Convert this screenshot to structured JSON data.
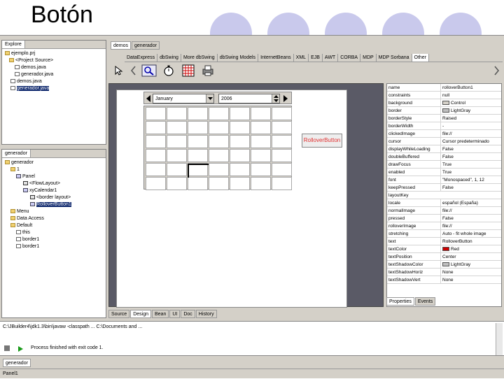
{
  "slide": {
    "title": "Botón"
  },
  "explorer": {
    "tabs": [
      "Explore"
    ],
    "nodes": [
      {
        "label": "ejemplo.prj",
        "icon": "folder"
      },
      {
        "label": "<Project Source>",
        "icon": "folder"
      },
      {
        "label": "demos.java",
        "icon": "file"
      },
      {
        "label": "generador.java",
        "icon": "file"
      },
      {
        "label": "demos.java",
        "icon": "file"
      },
      {
        "label": "generador.java",
        "icon": "file"
      }
    ]
  },
  "structure": {
    "tab": "generador",
    "nodes": [
      {
        "label": "generador",
        "icon": "folder"
      },
      {
        "label": "1",
        "icon": "folder"
      },
      {
        "label": "Panel",
        "icon": "comp"
      },
      {
        "label": "<FlowLayout>",
        "icon": "lay"
      },
      {
        "label": "xyCalendar1",
        "icon": "comp"
      },
      {
        "label": "<border layout>",
        "icon": "lay"
      },
      {
        "label": "RolloverButton1",
        "icon": "comp"
      },
      {
        "label": "Menu",
        "icon": "folder"
      },
      {
        "label": "Data Access",
        "icon": "folder"
      },
      {
        "label": "Default",
        "icon": "folder"
      },
      {
        "label": "this",
        "icon": "file"
      },
      {
        "label": "border1",
        "icon": "file"
      },
      {
        "label": "border1",
        "icon": "file"
      }
    ]
  },
  "editor_tabs": [
    "demos",
    "generador"
  ],
  "palette": {
    "tabs": [
      "DataExpress",
      "dbSwing",
      "More dbSwing",
      "dbSwing Models",
      "InternetBeans",
      "XML",
      "EJB",
      "AWT",
      "CORBA",
      "MDP",
      "MDP Sorbana",
      "Other"
    ],
    "active": "Other"
  },
  "calendar": {
    "month": "January",
    "year": "2006"
  },
  "rollover_button": {
    "label": "RolloverButton"
  },
  "properties": [
    {
      "name": "name",
      "value": "rolloverButton1"
    },
    {
      "name": "constraints",
      "value": "null"
    },
    {
      "name": "background",
      "value": "Control",
      "swatch": "#d4d0c8"
    },
    {
      "name": "border",
      "value": "LightGray",
      "swatch": "#c0c0c0"
    },
    {
      "name": "borderStyle",
      "value": "Raised"
    },
    {
      "name": "borderWidth",
      "value": "-"
    },
    {
      "name": "clickedImage",
      "value": "file://"
    },
    {
      "name": "cursor",
      "value": "Cursor predeterminado"
    },
    {
      "name": "displayWhileLoading",
      "value": "False"
    },
    {
      "name": "doubleBuffered",
      "value": "False"
    },
    {
      "name": "drawFocus",
      "value": "True"
    },
    {
      "name": "enabled",
      "value": "True"
    },
    {
      "name": "font",
      "value": "\"Monospaced\", 1, 12"
    },
    {
      "name": "keepPressed",
      "value": "False"
    },
    {
      "name": "layoutKey",
      "value": ""
    },
    {
      "name": "locale",
      "value": "español (España)"
    },
    {
      "name": "normalImage",
      "value": "file://"
    },
    {
      "name": "pressed",
      "value": "False"
    },
    {
      "name": "rolloverImage",
      "value": "file://"
    },
    {
      "name": "stretching",
      "value": "Auto - fit whole image"
    },
    {
      "name": "text",
      "value": "RolloverButton"
    },
    {
      "name": "textColor",
      "value": "Red",
      "swatch": "#cc0000"
    },
    {
      "name": "textPosition",
      "value": "Center"
    },
    {
      "name": "textShadowColor",
      "value": "LightGray",
      "swatch": "#c0c0c0"
    },
    {
      "name": "textShadowHoriz",
      "value": "None"
    },
    {
      "name": "textShadowVert",
      "value": "None"
    }
  ],
  "inspector_tabs": [
    "Properties",
    "Events"
  ],
  "bottom_tabs": [
    "Source",
    "Design",
    "Bean",
    "UI",
    "Doc",
    "History"
  ],
  "console": {
    "line": "C:\\JBuilder4\\jdk1.3\\bin\\javaw -classpath ... C:\\Documents and ...",
    "status_line": "Process finished with exit code 1.",
    "tab": "generador"
  },
  "statusbar": {
    "text": "Panel1"
  }
}
